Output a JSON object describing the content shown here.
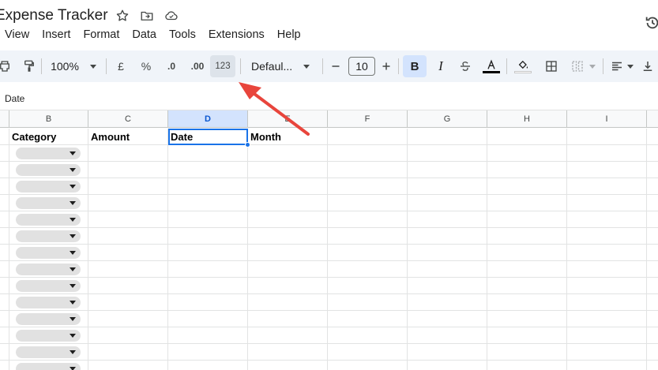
{
  "doc": {
    "title": "Expense Tracker"
  },
  "menu": [
    "View",
    "Insert",
    "Format",
    "Data",
    "Tools",
    "Extensions",
    "Help"
  ],
  "toolbar": {
    "zoom": "100%",
    "currency": "£",
    "percent": "%",
    "decrease_decimal": ".0",
    "increase_decimal": ".00",
    "number_format": "123",
    "font": "Defaul...",
    "font_size": "10",
    "bold": "B",
    "italic": "I"
  },
  "formula_bar": {
    "value": "Date"
  },
  "columns": [
    "B",
    "C",
    "D",
    "E",
    "F",
    "G",
    "H",
    "I"
  ],
  "selected_column": "D",
  "header_row": {
    "B": "Category",
    "C": "Amount",
    "D": "Date",
    "E": "Month"
  },
  "dropdown_rows": 14,
  "colors": {
    "accent": "#1a73e8",
    "selection": "#d3e3fd",
    "annotation_arrow": "#e8453c",
    "toolbar_bg": "#f0f4f9"
  }
}
